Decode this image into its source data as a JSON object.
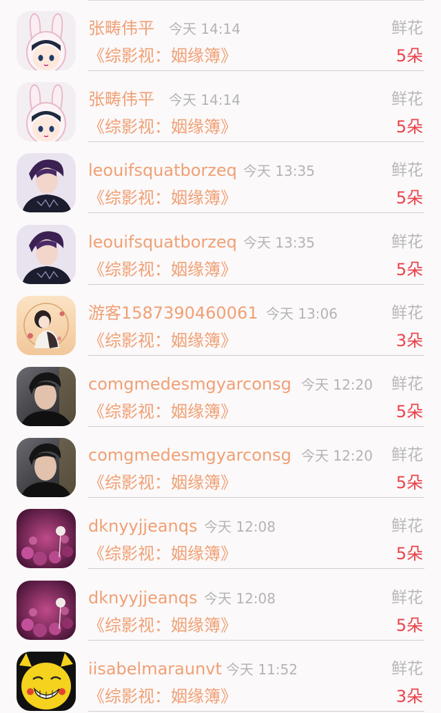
{
  "items": [
    {
      "name": "张畴伟平",
      "time": "今天 14:14",
      "gift_type": "鲜花",
      "work_title": "《综影视：姻缘簿》",
      "gift_count": "5朵",
      "avatar_icon": "bunny-hood-boy-avatar"
    },
    {
      "name": "张畴伟平",
      "time": "今天 14:14",
      "gift_type": "鲜花",
      "work_title": "《综影视：姻缘簿》",
      "gift_count": "5朵",
      "avatar_icon": "bunny-hood-boy-avatar"
    },
    {
      "name": "leouifsquatborzeq",
      "time": "今天 13:35",
      "gift_type": "鲜花",
      "work_title": "《综影视：姻缘簿》",
      "gift_count": "5朵",
      "avatar_icon": "purple-hair-man-avatar"
    },
    {
      "name": "leouifsquatborzeq",
      "time": "今天 13:35",
      "gift_type": "鲜花",
      "work_title": "《综影视：姻缘簿》",
      "gift_count": "5朵",
      "avatar_icon": "purple-hair-man-avatar"
    },
    {
      "name": "游客1587390460061",
      "time": "今天 13:06",
      "gift_type": "鲜花",
      "work_title": "《综影视：姻缘簿》",
      "gift_count": "3朵",
      "avatar_icon": "illustrated-couple-avatar"
    },
    {
      "name": "comgmedesmgyarconsg",
      "time": "今天 12:20",
      "gift_type": "鲜花",
      "work_title": "《综影视：姻缘簿》",
      "gift_count": "5朵",
      "avatar_icon": "man-portrait-avatar"
    },
    {
      "name": "comgmedesmgyarconsg",
      "time": "今天 12:20",
      "gift_type": "鲜花",
      "work_title": "《综影视：姻缘簿》",
      "gift_count": "5朵",
      "avatar_icon": "man-portrait-avatar"
    },
    {
      "name": "dknyyjjeanqs",
      "time": "今天 12:08",
      "gift_type": "鲜花",
      "work_title": "《综影视：姻缘簿》",
      "gift_count": "5朵",
      "avatar_icon": "dandelion-flowers-avatar"
    },
    {
      "name": "dknyyjjeanqs",
      "time": "今天 12:08",
      "gift_type": "鲜花",
      "work_title": "《综影视：姻缘簿》",
      "gift_count": "5朵",
      "avatar_icon": "dandelion-flowers-avatar"
    },
    {
      "name": "iisabelmaraunvt",
      "time": "今天 11:52",
      "gift_type": "鲜花",
      "work_title": "《综影视：姻缘簿》",
      "gift_count": "3朵",
      "avatar_icon": "yellow-meme-face-avatar"
    }
  ]
}
